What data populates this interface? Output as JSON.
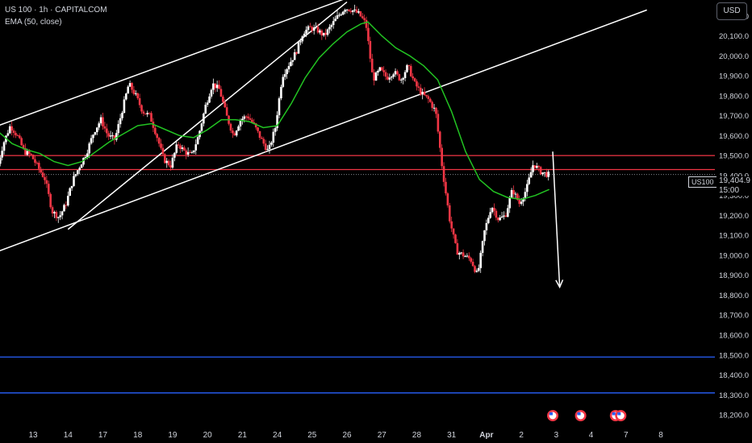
{
  "header": {
    "symbol_line": "US 100 · 1h · CAPITALCOM",
    "indicator_line": "EMA (50, close)"
  },
  "currency_button": "USD",
  "last_price": {
    "symbol": "US100",
    "value": "19,404.9",
    "countdown": "15:00",
    "price": 19404.9
  },
  "colors": {
    "background": "#000000",
    "up_candle": "#ffffff",
    "down_candle": "#f23645",
    "ema": "#22c322",
    "resistance": "#f23645",
    "support": "#2962ff",
    "channel": "#ffffff",
    "axis_text": "#d1d4dc"
  },
  "chart_data": {
    "type": "candlestick",
    "y_axis": {
      "range": [
        18180,
        20280
      ],
      "ticks": [
        18200,
        18300,
        18400,
        18500,
        18600,
        18700,
        18800,
        18900,
        19000,
        19100,
        19200,
        19300,
        19400,
        19500,
        19600,
        19700,
        19800,
        19900,
        20000,
        20100,
        20200
      ],
      "tick_labels": [
        "18,200.0",
        "18,300.0",
        "18,400.0",
        "18,500.0",
        "18,600.0",
        "18,700.0",
        "18,800.0",
        "18,900.0",
        "19,000.0",
        "19,100.0",
        "19,200.0",
        "19,300.0",
        "19,400.0",
        "19,500.0",
        "19,600.0",
        "19,700.0",
        "19,800.0",
        "19,900.0",
        "20,000.0",
        "20,100.0",
        "20,200.0"
      ]
    },
    "x_axis": {
      "labels": [
        "13",
        "14",
        "17",
        "18",
        "19",
        "20",
        "21",
        "24",
        "25",
        "26",
        "27",
        "28",
        "31",
        "Apr",
        "2",
        "3",
        "4",
        "7",
        "8"
      ],
      "label_positions": [
        0,
        1,
        2,
        3,
        4,
        5,
        6,
        7,
        8,
        9,
        10,
        11,
        12,
        13,
        14,
        15,
        16,
        17,
        18
      ],
      "range": [
        -0.95,
        19.55
      ]
    },
    "ohlc_daily_path": [
      {
        "x": -1.0,
        "p": 19420
      },
      {
        "x": -0.8,
        "p": 19560
      },
      {
        "x": -0.6,
        "p": 19650
      },
      {
        "x": -0.4,
        "p": 19600
      },
      {
        "x": -0.2,
        "p": 19520
      },
      {
        "x": 0.0,
        "p": 19500
      },
      {
        "x": 0.2,
        "p": 19440
      },
      {
        "x": 0.4,
        "p": 19380
      },
      {
        "x": 0.6,
        "p": 19220
      },
      {
        "x": 0.8,
        "p": 19190
      },
      {
        "x": 1.0,
        "p": 19260
      },
      {
        "x": 1.2,
        "p": 19380
      },
      {
        "x": 1.4,
        "p": 19450
      },
      {
        "x": 1.6,
        "p": 19520
      },
      {
        "x": 1.8,
        "p": 19620
      },
      {
        "x": 2.0,
        "p": 19680
      },
      {
        "x": 2.2,
        "p": 19600
      },
      {
        "x": 2.4,
        "p": 19580
      },
      {
        "x": 2.6,
        "p": 19720
      },
      {
        "x": 2.8,
        "p": 19860
      },
      {
        "x": 3.0,
        "p": 19800
      },
      {
        "x": 3.2,
        "p": 19720
      },
      {
        "x": 3.4,
        "p": 19700
      },
      {
        "x": 3.6,
        "p": 19600
      },
      {
        "x": 3.8,
        "p": 19480
      },
      {
        "x": 4.0,
        "p": 19450
      },
      {
        "x": 4.2,
        "p": 19560
      },
      {
        "x": 4.4,
        "p": 19520
      },
      {
        "x": 4.6,
        "p": 19500
      },
      {
        "x": 4.8,
        "p": 19600
      },
      {
        "x": 5.0,
        "p": 19750
      },
      {
        "x": 5.2,
        "p": 19860
      },
      {
        "x": 5.4,
        "p": 19830
      },
      {
        "x": 5.6,
        "p": 19700
      },
      {
        "x": 5.8,
        "p": 19600
      },
      {
        "x": 6.0,
        "p": 19680
      },
      {
        "x": 6.2,
        "p": 19700
      },
      {
        "x": 6.4,
        "p": 19650
      },
      {
        "x": 6.6,
        "p": 19580
      },
      {
        "x": 6.8,
        "p": 19520
      },
      {
        "x": 7.0,
        "p": 19640
      },
      {
        "x": 7.2,
        "p": 19900
      },
      {
        "x": 7.4,
        "p": 19960
      },
      {
        "x": 7.6,
        "p": 20020
      },
      {
        "x": 7.8,
        "p": 20120
      },
      {
        "x": 8.0,
        "p": 20140
      },
      {
        "x": 8.2,
        "p": 20130
      },
      {
        "x": 8.4,
        "p": 20100
      },
      {
        "x": 8.6,
        "p": 20150
      },
      {
        "x": 8.8,
        "p": 20200
      },
      {
        "x": 9.0,
        "p": 20240
      },
      {
        "x": 9.2,
        "p": 20230
      },
      {
        "x": 9.4,
        "p": 20210
      },
      {
        "x": 9.6,
        "p": 20160
      },
      {
        "x": 9.8,
        "p": 19880
      },
      {
        "x": 10.0,
        "p": 19930
      },
      {
        "x": 10.2,
        "p": 19890
      },
      {
        "x": 10.4,
        "p": 19920
      },
      {
        "x": 10.6,
        "p": 19880
      },
      {
        "x": 10.8,
        "p": 19950
      },
      {
        "x": 11.0,
        "p": 19860
      },
      {
        "x": 11.2,
        "p": 19810
      },
      {
        "x": 11.4,
        "p": 19780
      },
      {
        "x": 11.6,
        "p": 19720
      },
      {
        "x": 11.8,
        "p": 19420
      },
      {
        "x": 12.0,
        "p": 19180
      },
      {
        "x": 12.2,
        "p": 19020
      },
      {
        "x": 12.4,
        "p": 19000
      },
      {
        "x": 12.6,
        "p": 18980
      },
      {
        "x": 12.8,
        "p": 18900
      },
      {
        "x": 13.0,
        "p": 19120
      },
      {
        "x": 13.2,
        "p": 19250
      },
      {
        "x": 13.4,
        "p": 19180
      },
      {
        "x": 13.6,
        "p": 19200
      },
      {
        "x": 13.8,
        "p": 19330
      },
      {
        "x": 14.0,
        "p": 19260
      },
      {
        "x": 14.2,
        "p": 19330
      },
      {
        "x": 14.4,
        "p": 19460
      },
      {
        "x": 14.6,
        "p": 19420
      },
      {
        "x": 14.8,
        "p": 19405
      }
    ],
    "ema_path": [
      {
        "x": -1.0,
        "p": 19620
      },
      {
        "x": -0.6,
        "p": 19560
      },
      {
        "x": -0.2,
        "p": 19530
      },
      {
        "x": 0.2,
        "p": 19510
      },
      {
        "x": 0.6,
        "p": 19470
      },
      {
        "x": 1.0,
        "p": 19450
      },
      {
        "x": 1.4,
        "p": 19470
      },
      {
        "x": 1.8,
        "p": 19520
      },
      {
        "x": 2.2,
        "p": 19570
      },
      {
        "x": 2.6,
        "p": 19610
      },
      {
        "x": 3.0,
        "p": 19650
      },
      {
        "x": 3.4,
        "p": 19660
      },
      {
        "x": 3.8,
        "p": 19630
      },
      {
        "x": 4.2,
        "p": 19600
      },
      {
        "x": 4.6,
        "p": 19590
      },
      {
        "x": 5.0,
        "p": 19630
      },
      {
        "x": 5.4,
        "p": 19680
      },
      {
        "x": 5.8,
        "p": 19680
      },
      {
        "x": 6.2,
        "p": 19670
      },
      {
        "x": 6.6,
        "p": 19640
      },
      {
        "x": 7.0,
        "p": 19650
      },
      {
        "x": 7.4,
        "p": 19760
      },
      {
        "x": 7.8,
        "p": 19890
      },
      {
        "x": 8.2,
        "p": 19990
      },
      {
        "x": 8.6,
        "p": 20060
      },
      {
        "x": 9.0,
        "p": 20120
      },
      {
        "x": 9.4,
        "p": 20160
      },
      {
        "x": 9.6,
        "p": 20170
      },
      {
        "x": 10.0,
        "p": 20100
      },
      {
        "x": 10.4,
        "p": 20040
      },
      {
        "x": 10.8,
        "p": 20000
      },
      {
        "x": 11.2,
        "p": 19950
      },
      {
        "x": 11.6,
        "p": 19880
      },
      {
        "x": 12.0,
        "p": 19720
      },
      {
        "x": 12.4,
        "p": 19520
      },
      {
        "x": 12.8,
        "p": 19380
      },
      {
        "x": 13.2,
        "p": 19320
      },
      {
        "x": 13.6,
        "p": 19290
      },
      {
        "x": 14.0,
        "p": 19280
      },
      {
        "x": 14.4,
        "p": 19300
      },
      {
        "x": 14.8,
        "p": 19330
      }
    ],
    "horizontal_levels": [
      {
        "price": 19500,
        "color": "#f23645"
      },
      {
        "price": 19430,
        "color": "#f23645"
      },
      {
        "price": 18490,
        "color": "#2962ff"
      },
      {
        "price": 18310,
        "color": "#2962ff"
      }
    ],
    "channel_lines": [
      {
        "from": {
          "x": -1.0,
          "p": 19650
        },
        "to": {
          "x": 9.0,
          "p": 20290
        }
      },
      {
        "from": {
          "x": -1.0,
          "p": 19020
        },
        "to": {
          "x": 17.6,
          "p": 20230
        }
      }
    ],
    "channel_lower_extension_segment": {
      "from": {
        "x": 1.0,
        "p": 19130
      },
      "to": {
        "x": 9.0,
        "p": 20270
      }
    },
    "projection_arrow": {
      "from": {
        "x": 14.9,
        "p": 19520
      },
      "to": {
        "x": 15.1,
        "p": 18840
      }
    },
    "event_markers": [
      {
        "x": 14.9
      },
      {
        "x": 15.7
      },
      {
        "x": 16.7
      },
      {
        "x": 16.85
      }
    ]
  }
}
